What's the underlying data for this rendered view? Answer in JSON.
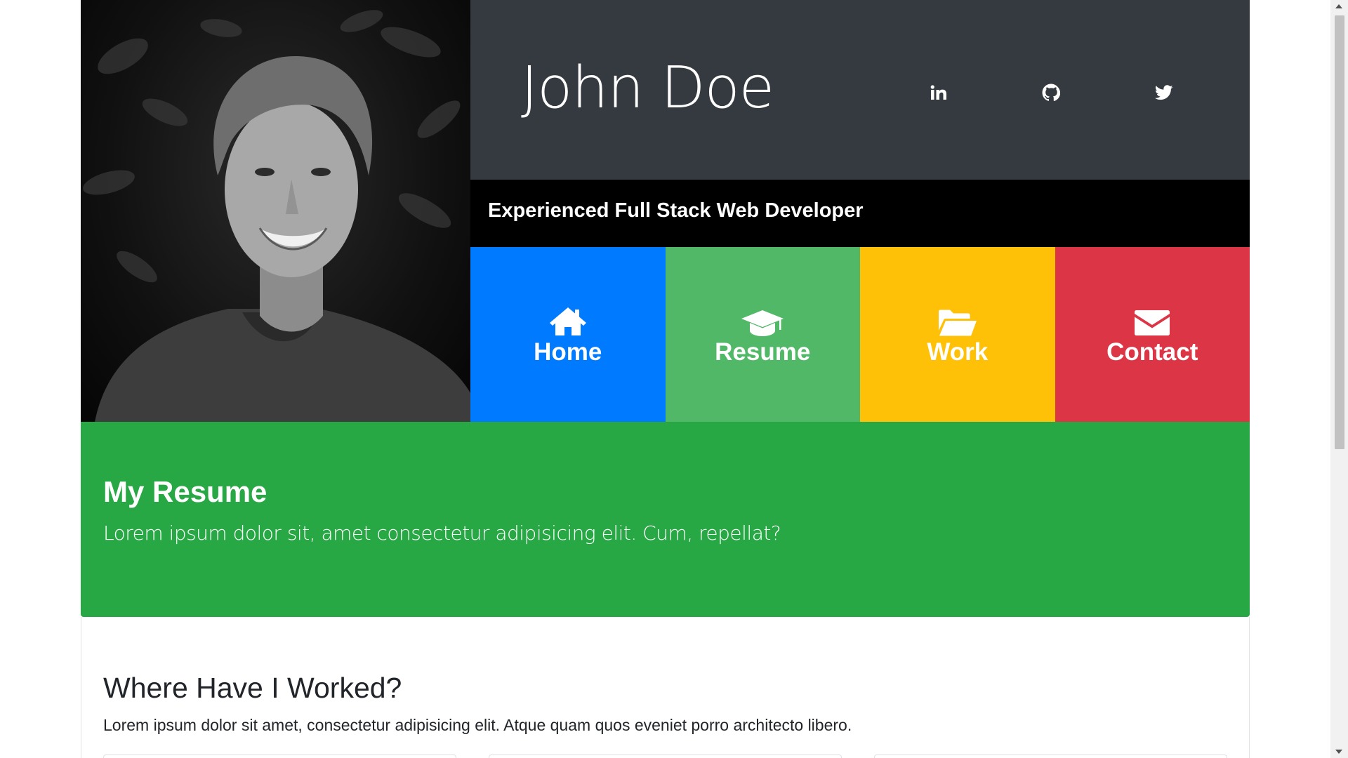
{
  "profile": {
    "name": "John Doe",
    "tagline": "Experienced Full Stack Web Developer",
    "photo_alt": "portrait"
  },
  "social": [
    {
      "icon": "linkedin-icon"
    },
    {
      "icon": "github-icon"
    },
    {
      "icon": "twitter-icon"
    },
    {
      "icon": "facebook-icon"
    }
  ],
  "nav": [
    {
      "label": "Home",
      "icon": "home-icon",
      "color": "#007bff"
    },
    {
      "label": "Resume",
      "icon": "graduation-cap-icon",
      "color": "#51b868"
    },
    {
      "label": "Work",
      "icon": "folder-open-icon",
      "color": "#ffc107"
    },
    {
      "label": "Contact",
      "icon": "envelope-icon",
      "color": "#dc3545"
    }
  ],
  "banner": {
    "title": "My Resume",
    "text": "Lorem ipsum dolor sit, amet consectetur adipisicing elit. Cum, repellat?",
    "color": "#28a745"
  },
  "worked": {
    "title": "Where Have I Worked?",
    "text": "Lorem ipsum dolor sit amet, consectetur adipisicing elit. Atque quam quos eveniet porro architecto libero."
  },
  "colors": {
    "header_dark": "#343a40",
    "tagline_bg": "#000000"
  }
}
